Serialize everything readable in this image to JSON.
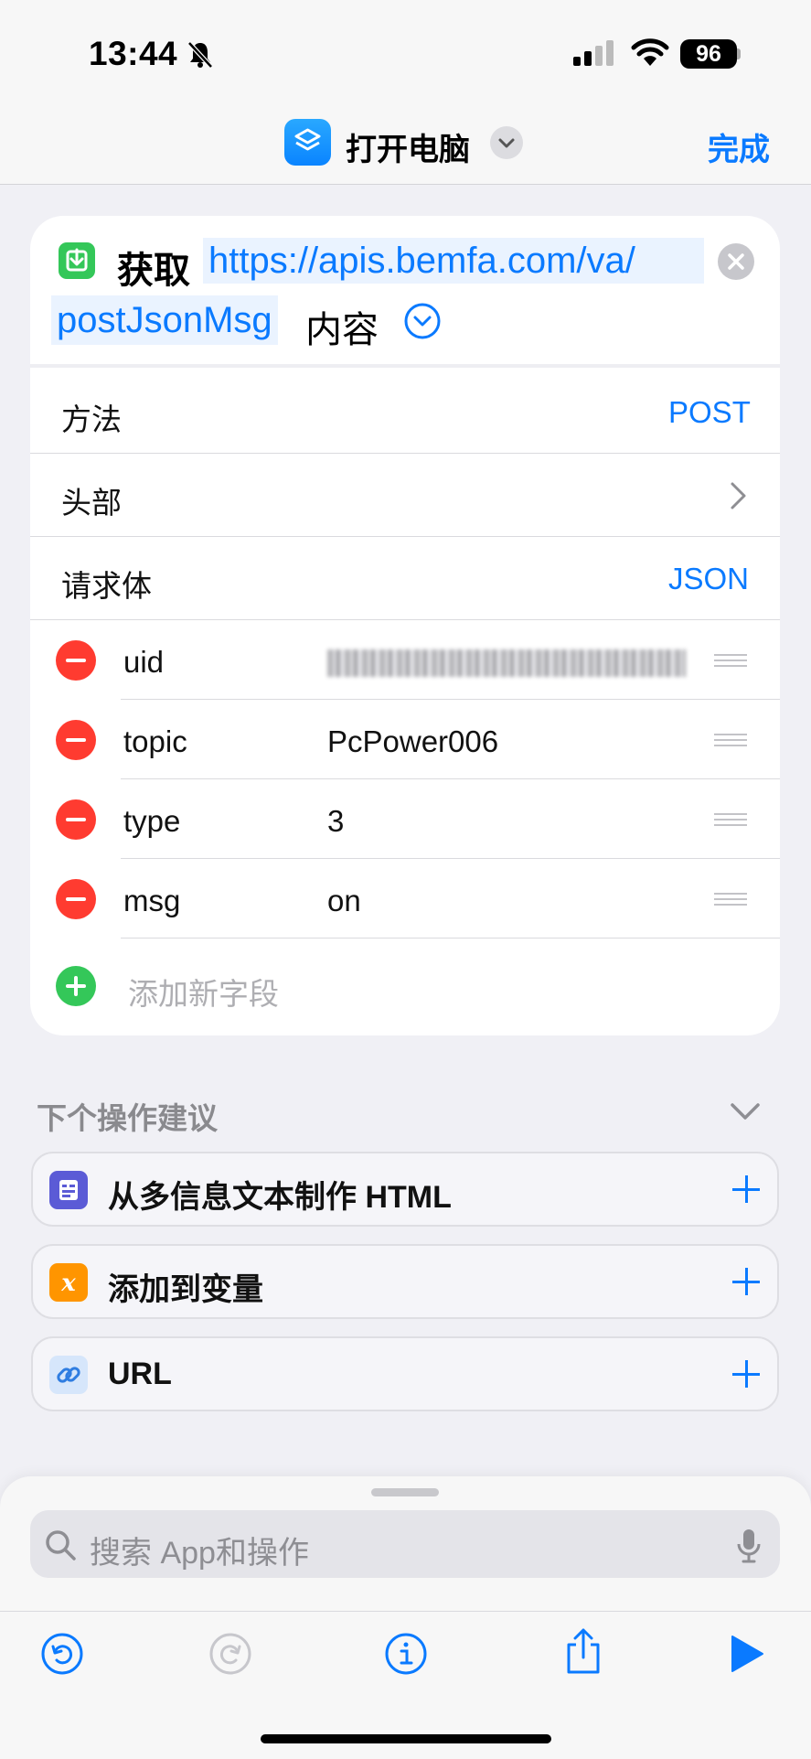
{
  "status_bar": {
    "time": "13:44",
    "battery": "96"
  },
  "nav": {
    "title": "打开电脑",
    "done_label": "完成"
  },
  "action": {
    "verb": "获取",
    "url_part1": "https://apis.bemfa.com/va/",
    "url_part2": "postJsonMsg",
    "suffix": "内容",
    "rows": [
      {
        "label": "方法",
        "value": "POST"
      },
      {
        "label": "头部",
        "value": ""
      },
      {
        "label": "请求体",
        "value": "JSON"
      }
    ],
    "fields": [
      {
        "key": "uid",
        "value": ""
      },
      {
        "key": "topic",
        "value": "PcPower006"
      },
      {
        "key": "type",
        "value": "3"
      },
      {
        "key": "msg",
        "value": "on"
      }
    ],
    "add_field_placeholder": "添加新字段"
  },
  "suggestions": {
    "title": "下个操作建议",
    "items": [
      {
        "label": "从多信息文本制作 HTML",
        "icon": "rich-text-icon",
        "color": "#5b5bd6"
      },
      {
        "label": "添加到变量",
        "icon": "variable-icon",
        "color": "#ff9500"
      },
      {
        "label": "URL",
        "icon": "link-icon",
        "color": "#d6e6fb"
      }
    ]
  },
  "search": {
    "placeholder": "搜索 App和操作"
  },
  "colors": {
    "accent": "#0a7aff",
    "remove": "#ff3b30",
    "add": "#34c759"
  }
}
